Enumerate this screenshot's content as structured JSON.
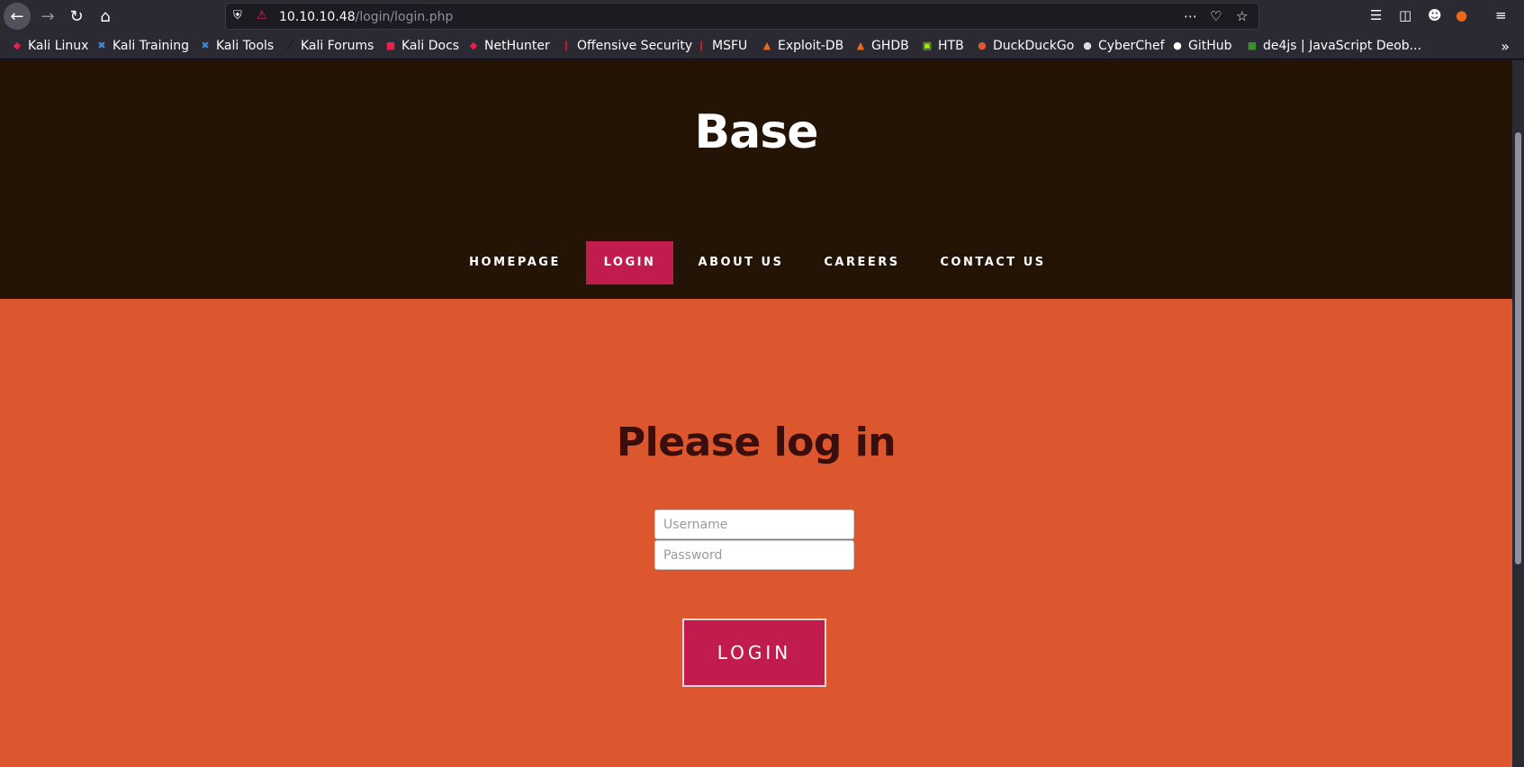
{
  "browser": {
    "url_host": "10.10.10.48",
    "url_path": "/login/login.php",
    "bookmarks": [
      {
        "label": "Kali Linux",
        "icon": "kali-dragon-icon",
        "color": "#e8234b"
      },
      {
        "label": "Kali Training",
        "icon": "kali-training-icon",
        "color": "#3b8bd9"
      },
      {
        "label": "Kali Tools",
        "icon": "kali-tools-icon",
        "color": "#3b8bd9"
      },
      {
        "label": "Kali Forums",
        "icon": "kali-forums-icon",
        "color": "#1a1a1a"
      },
      {
        "label": "Kali Docs",
        "icon": "kali-docs-icon",
        "color": "#e8234b"
      },
      {
        "label": "NetHunter",
        "icon": "nethunter-icon",
        "color": "#e8234b"
      },
      {
        "label": "Offensive Security",
        "icon": "offsec-icon",
        "color": "#d02020"
      },
      {
        "label": "MSFU",
        "icon": "msfu-icon",
        "color": "#d02020"
      },
      {
        "label": "Exploit-DB",
        "icon": "exploit-db-icon",
        "color": "#e86a1a"
      },
      {
        "label": "GHDB",
        "icon": "ghdb-icon",
        "color": "#e86a1a"
      },
      {
        "label": "HTB",
        "icon": "htb-cube-icon",
        "color": "#9fef00"
      },
      {
        "label": "DuckDuckGo",
        "icon": "duckduckgo-icon",
        "color": "#de5833"
      },
      {
        "label": "CyberChef",
        "icon": "cyberchef-icon",
        "color": "#dddddd"
      },
      {
        "label": "GitHub",
        "icon": "github-icon",
        "color": "#ffffff"
      },
      {
        "label": "de4js | JavaScript Deob...",
        "icon": "de4js-icon",
        "color": "#3c8d2f"
      }
    ]
  },
  "site": {
    "title": "Base",
    "nav": [
      {
        "label": "HOMEPAGE",
        "active": false
      },
      {
        "label": "LOGIN",
        "active": true
      },
      {
        "label": "ABOUT US",
        "active": false
      },
      {
        "label": "CAREERS",
        "active": false
      },
      {
        "label": "CONTACT US",
        "active": false
      }
    ]
  },
  "login": {
    "heading": "Please log in",
    "username_placeholder": "Username",
    "password_placeholder": "Password",
    "button_label": "LOGIN"
  },
  "colors": {
    "header_bg": "#231405",
    "accent": "#c01c4e",
    "main_bg": "#dc572e",
    "heading_text": "#3a0e0c"
  }
}
